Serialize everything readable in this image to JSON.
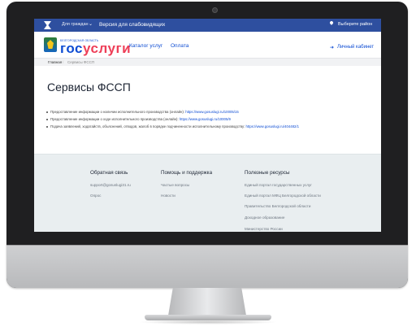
{
  "topbar": {
    "citizens": "Для граждан",
    "citizens_chevron": "⌄",
    "version": "Версия для слабовидящих",
    "region": "Выберите район"
  },
  "header": {
    "logo_small": "БЕЛГОРОДСКАЯ ОБЛАСТЬ",
    "logo_part1": "гос",
    "logo_part2": "услуги",
    "catalog": "Каталог услуг",
    "payment": "Оплата",
    "cabinet": "Личный кабинет"
  },
  "breadcrumb": {
    "home": "Главная",
    "separator": "/",
    "current": "Сервисы ФССП"
  },
  "page": {
    "title": "Сервисы ФССП",
    "services": [
      {
        "text": "Предоставление информации о наличии исполнительного производства (онлайн):",
        "link": "https://www.gosuslugi.ru/10005/15"
      },
      {
        "text": "Предоставление информации о ходе исполнительного производства (онлайн):",
        "link": "https://www.gosuslugi.ru/10005/9"
      },
      {
        "text": "Подача заявлений, ходатайств, объяснений, отводов, жалоб в порядке подчиненности исполнительному производству:",
        "link": "https://www.gosuslugi.ru/404482/1"
      }
    ]
  },
  "footer": {
    "col1": {
      "heading": "Обратная связь",
      "links": [
        "support@gosuslugi31.ru",
        "Опрос"
      ]
    },
    "col2": {
      "heading": "Помощь и поддержка",
      "links": [
        "Частые вопросы",
        "Новости"
      ]
    },
    "col3": {
      "heading": "Полезные ресурсы",
      "links": [
        "Единый портал государственных услуг",
        "Единый портал МФЦ Белгородской области",
        "Правительство Белгородской области",
        "Доходное образование",
        "Министерство России"
      ]
    }
  },
  "colors": {
    "topbar": "#2e4f9f",
    "brand_blue": "#0d4cd3",
    "brand_red": "#ee3f58",
    "footer_bg": "#e9eef0"
  },
  "icons": {
    "topbar_logo": "coat-of-arms-icon",
    "region": "location-pin-icon",
    "cabinet": "login-arrow-icon"
  }
}
